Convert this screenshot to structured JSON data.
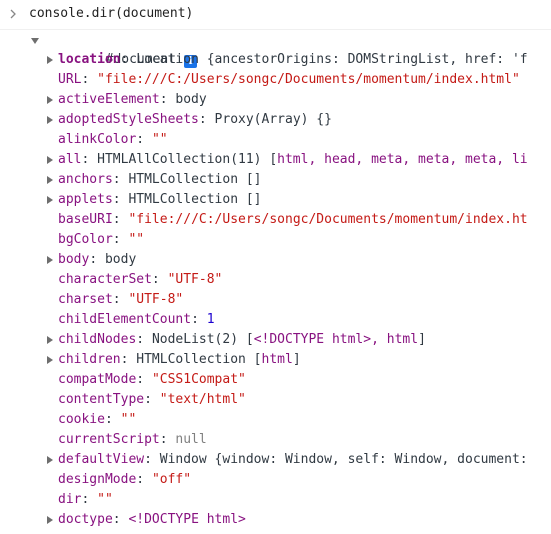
{
  "command": "console.dir(document)",
  "root_label": "#document",
  "rows": [
    {
      "key": "location",
      "bold": true,
      "expand": true,
      "parts": [
        {
          "t": ": ",
          "c": "punct"
        },
        {
          "t": "Location {ancestorOrigins: DOMStringList, href: 'f",
          "c": "plain"
        }
      ]
    },
    {
      "key": "URL",
      "expand": false,
      "parts": [
        {
          "t": ": ",
          "c": "punct"
        },
        {
          "t": "\"file:///C:/Users/songc/Documents/momentum/index.html\"",
          "c": "str"
        }
      ]
    },
    {
      "key": "activeElement",
      "expand": true,
      "parts": [
        {
          "t": ": ",
          "c": "punct"
        },
        {
          "t": "body",
          "c": "plain"
        }
      ]
    },
    {
      "key": "adoptedStyleSheets",
      "expand": true,
      "parts": [
        {
          "t": ": ",
          "c": "punct"
        },
        {
          "t": "Proxy(Array) {}",
          "c": "plain"
        }
      ]
    },
    {
      "key": "alinkColor",
      "expand": false,
      "parts": [
        {
          "t": ": ",
          "c": "punct"
        },
        {
          "t": "\"\"",
          "c": "str"
        }
      ]
    },
    {
      "key": "all",
      "expand": true,
      "parts": [
        {
          "t": ": ",
          "c": "punct"
        },
        {
          "t": "HTMLAllCollection(11) [",
          "c": "plain"
        },
        {
          "t": "html, head, meta, meta, meta, li",
          "c": "k"
        }
      ]
    },
    {
      "key": "anchors",
      "expand": true,
      "parts": [
        {
          "t": ": ",
          "c": "punct"
        },
        {
          "t": "HTMLCollection []",
          "c": "plain"
        }
      ]
    },
    {
      "key": "applets",
      "expand": true,
      "parts": [
        {
          "t": ": ",
          "c": "punct"
        },
        {
          "t": "HTMLCollection []",
          "c": "plain"
        }
      ]
    },
    {
      "key": "baseURI",
      "expand": false,
      "parts": [
        {
          "t": ": ",
          "c": "punct"
        },
        {
          "t": "\"file:///C:/Users/songc/Documents/momentum/index.ht",
          "c": "str"
        }
      ]
    },
    {
      "key": "bgColor",
      "expand": false,
      "parts": [
        {
          "t": ": ",
          "c": "punct"
        },
        {
          "t": "\"\"",
          "c": "str"
        }
      ]
    },
    {
      "key": "body",
      "expand": true,
      "parts": [
        {
          "t": ": ",
          "c": "punct"
        },
        {
          "t": "body",
          "c": "plain"
        }
      ]
    },
    {
      "key": "characterSet",
      "expand": false,
      "parts": [
        {
          "t": ": ",
          "c": "punct"
        },
        {
          "t": "\"UTF-8\"",
          "c": "str"
        }
      ]
    },
    {
      "key": "charset",
      "expand": false,
      "parts": [
        {
          "t": ": ",
          "c": "punct"
        },
        {
          "t": "\"UTF-8\"",
          "c": "str"
        }
      ]
    },
    {
      "key": "childElementCount",
      "expand": false,
      "parts": [
        {
          "t": ": ",
          "c": "punct"
        },
        {
          "t": "1",
          "c": "num"
        }
      ]
    },
    {
      "key": "childNodes",
      "expand": true,
      "parts": [
        {
          "t": ": ",
          "c": "punct"
        },
        {
          "t": "NodeList(2) [",
          "c": "plain"
        },
        {
          "t": "<!DOCTYPE html>, html",
          "c": "k"
        },
        {
          "t": "]",
          "c": "plain"
        }
      ]
    },
    {
      "key": "children",
      "expand": true,
      "parts": [
        {
          "t": ": ",
          "c": "punct"
        },
        {
          "t": "HTMLCollection [",
          "c": "plain"
        },
        {
          "t": "html",
          "c": "k"
        },
        {
          "t": "]",
          "c": "plain"
        }
      ]
    },
    {
      "key": "compatMode",
      "expand": false,
      "parts": [
        {
          "t": ": ",
          "c": "punct"
        },
        {
          "t": "\"CSS1Compat\"",
          "c": "str"
        }
      ]
    },
    {
      "key": "contentType",
      "expand": false,
      "parts": [
        {
          "t": ": ",
          "c": "punct"
        },
        {
          "t": "\"text/html\"",
          "c": "str"
        }
      ]
    },
    {
      "key": "cookie",
      "expand": false,
      "parts": [
        {
          "t": ": ",
          "c": "punct"
        },
        {
          "t": "\"\"",
          "c": "str"
        }
      ]
    },
    {
      "key": "currentScript",
      "expand": false,
      "parts": [
        {
          "t": ": ",
          "c": "punct"
        },
        {
          "t": "null",
          "c": "null"
        }
      ]
    },
    {
      "key": "defaultView",
      "expand": true,
      "parts": [
        {
          "t": ": ",
          "c": "punct"
        },
        {
          "t": "Window {window: Window, self: Window, document:",
          "c": "plain"
        }
      ]
    },
    {
      "key": "designMode",
      "expand": false,
      "parts": [
        {
          "t": ": ",
          "c": "punct"
        },
        {
          "t": "\"off\"",
          "c": "str"
        }
      ]
    },
    {
      "key": "dir",
      "expand": false,
      "parts": [
        {
          "t": ": ",
          "c": "punct"
        },
        {
          "t": "\"\"",
          "c": "str"
        }
      ]
    },
    {
      "key": "doctype",
      "expand": true,
      "parts": [
        {
          "t": ": ",
          "c": "punct"
        },
        {
          "t": "<!DOCTYPE html>",
          "c": "k"
        }
      ]
    }
  ],
  "colors": {
    "key": "#881280",
    "string": "#c41a16",
    "number": "#1c00cf",
    "null": "#808080",
    "info_badge": "#1a73e8"
  },
  "icons": {
    "prompt": "chevron-right-icon",
    "expand": "triangle-right-icon",
    "collapse": "triangle-down-icon",
    "info": "info-icon"
  }
}
